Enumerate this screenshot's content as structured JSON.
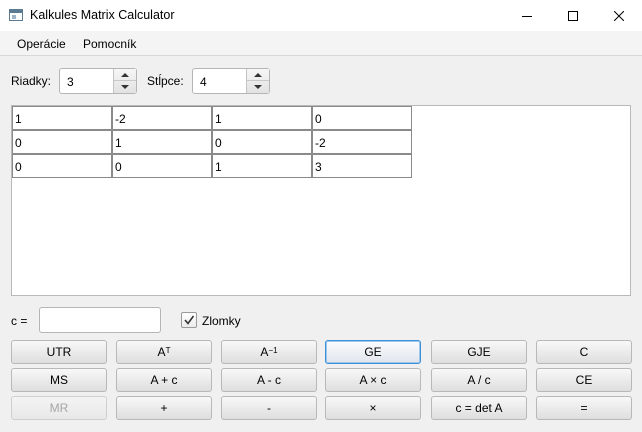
{
  "window": {
    "title": "Kalkules Matrix Calculator",
    "controls": {
      "minimize": "minimize",
      "maximize": "maximize",
      "close": "close"
    }
  },
  "menu": {
    "items": [
      "Operácie",
      "Pomocník"
    ]
  },
  "dimensions": {
    "rows_label": "Riadky:",
    "rows_value": "3",
    "cols_label": "Stĺpce:",
    "cols_value": "4"
  },
  "matrix": {
    "rows": [
      [
        "1",
        "-2",
        "1",
        "0"
      ],
      [
        "0",
        "1",
        "0",
        "-2"
      ],
      [
        "0",
        "0",
        "1",
        "3"
      ]
    ]
  },
  "constant": {
    "label": "c =",
    "value": ""
  },
  "fractions": {
    "label": "Zlomky",
    "checked": true
  },
  "buttons": {
    "row1": [
      {
        "label": "UTR",
        "name": "utr-button"
      },
      {
        "label": "A",
        "sup": "T",
        "name": "transpose-button"
      },
      {
        "label": "A",
        "sup": "−1",
        "name": "inverse-button"
      },
      {
        "label": "GE",
        "name": "ge-button",
        "focused": true
      },
      {
        "label": "GJE",
        "name": "gje-button"
      },
      {
        "label": "C",
        "name": "clear-button"
      }
    ],
    "row2": [
      {
        "label": "MS",
        "name": "memory-store-button"
      },
      {
        "label": "A + c",
        "name": "add-constant-button"
      },
      {
        "label": "A - c",
        "name": "subtract-constant-button"
      },
      {
        "label": "A × c",
        "name": "multiply-constant-button"
      },
      {
        "label": "A / c",
        "name": "divide-constant-button"
      },
      {
        "label": "CE",
        "name": "clear-entry-button"
      }
    ],
    "row3": [
      {
        "label": "MR",
        "name": "memory-recall-button",
        "disabled": true
      },
      {
        "label": "+",
        "name": "add-button"
      },
      {
        "label": "-",
        "name": "subtract-button"
      },
      {
        "label": "×",
        "name": "multiply-button"
      },
      {
        "label": "c = det A",
        "name": "determinant-button"
      },
      {
        "label": "=",
        "name": "equals-button"
      }
    ]
  }
}
